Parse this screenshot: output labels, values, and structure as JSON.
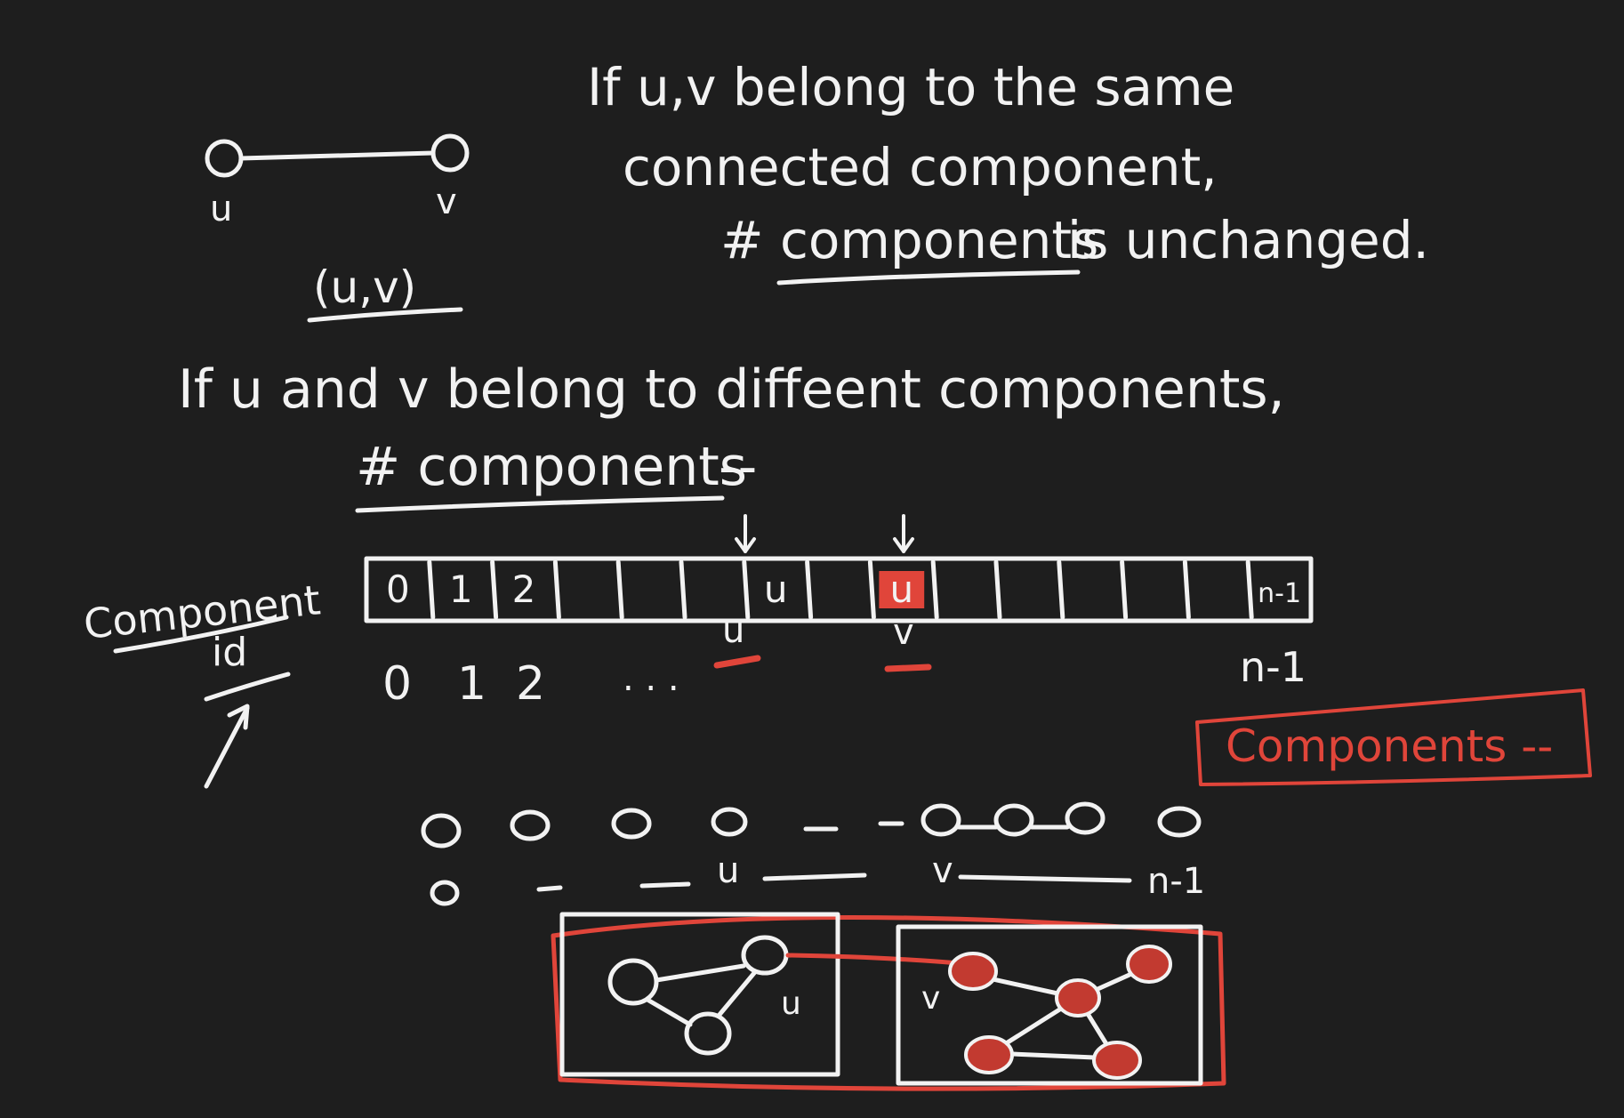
{
  "edge_diagram": {
    "u_label": "u",
    "v_label": "v",
    "edge_label": "(u,v)"
  },
  "same_component_note": {
    "line1": "If u,v belong to the same",
    "line2": "connected component,",
    "line3_prefix": "# components",
    "line3_suffix": " is unchanged."
  },
  "different_component_note": {
    "line1": "If u and v belong to diffeent components,",
    "line2_prefix": "# components",
    "line2_suffix": " --"
  },
  "component_id": {
    "label_line1": "Component",
    "label_line2": "id"
  },
  "array": {
    "cells": [
      "0",
      "1",
      "2",
      "",
      "",
      "",
      "u",
      "",
      "u",
      "",
      "",
      "",
      "",
      "",
      "n-1"
    ],
    "highlighted_cell_index": 8,
    "indices": {
      "i0": "0",
      "i1": "1",
      "i2": "2",
      "dots": ". . .",
      "u": "u",
      "v": "v",
      "last": "n-1"
    }
  },
  "components_box": {
    "label": "Components --"
  },
  "node_row": {
    "dashes": "— — - o-o-o",
    "bottom_labels": {
      "zero": "o",
      "u": "u",
      "v": "v",
      "last": "n-1"
    }
  },
  "graph_panels": {
    "left_label": "u",
    "right_label": "v"
  },
  "colors": {
    "background": "#1e1e1e",
    "chalk": "#f2f2f2",
    "highlight": "#e0453a"
  }
}
